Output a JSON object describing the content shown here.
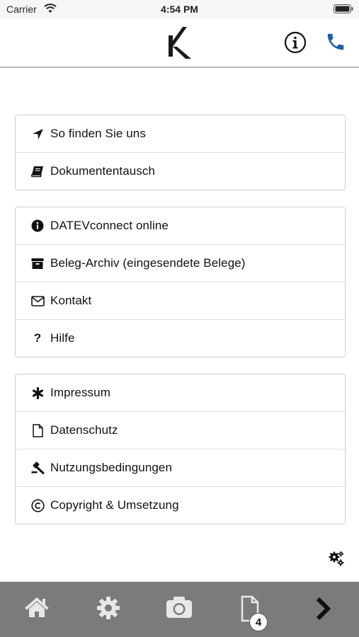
{
  "status_bar": {
    "carrier": "Carrier",
    "time": "4:54 PM"
  },
  "header": {
    "logo_icon": "k-logo-icon",
    "info_icon": "info-icon",
    "phone_icon": "phone-icon",
    "accent": "#1c5ea8"
  },
  "groups": [
    {
      "items": [
        {
          "label": "So finden Sie uns",
          "icon": "location-arrow-icon"
        },
        {
          "label": "Dokumententausch",
          "icon": "book-icon"
        }
      ]
    },
    {
      "items": [
        {
          "label": "DATEVconnect online",
          "icon": "info-circle-icon"
        },
        {
          "label": "Beleg-Archiv (eingesendete Belege)",
          "icon": "archive-icon"
        },
        {
          "label": "Kontakt",
          "icon": "envelope-icon"
        },
        {
          "label": "Hilfe",
          "icon": "question-icon"
        }
      ]
    },
    {
      "items": [
        {
          "label": "Impressum",
          "icon": "asterisk-icon"
        },
        {
          "label": "Datenschutz",
          "icon": "file-icon"
        },
        {
          "label": "Nutzungsbedingungen",
          "icon": "gavel-icon"
        },
        {
          "label": "Copyright & Umsetzung",
          "icon": "copyright-icon"
        }
      ]
    }
  ],
  "tab_bar": {
    "background": "#7b7b7b",
    "items": [
      "home-icon",
      "gear-icon",
      "camera-icon",
      "document-icon",
      "chevron-right-icon"
    ],
    "documents_badge": "4"
  }
}
